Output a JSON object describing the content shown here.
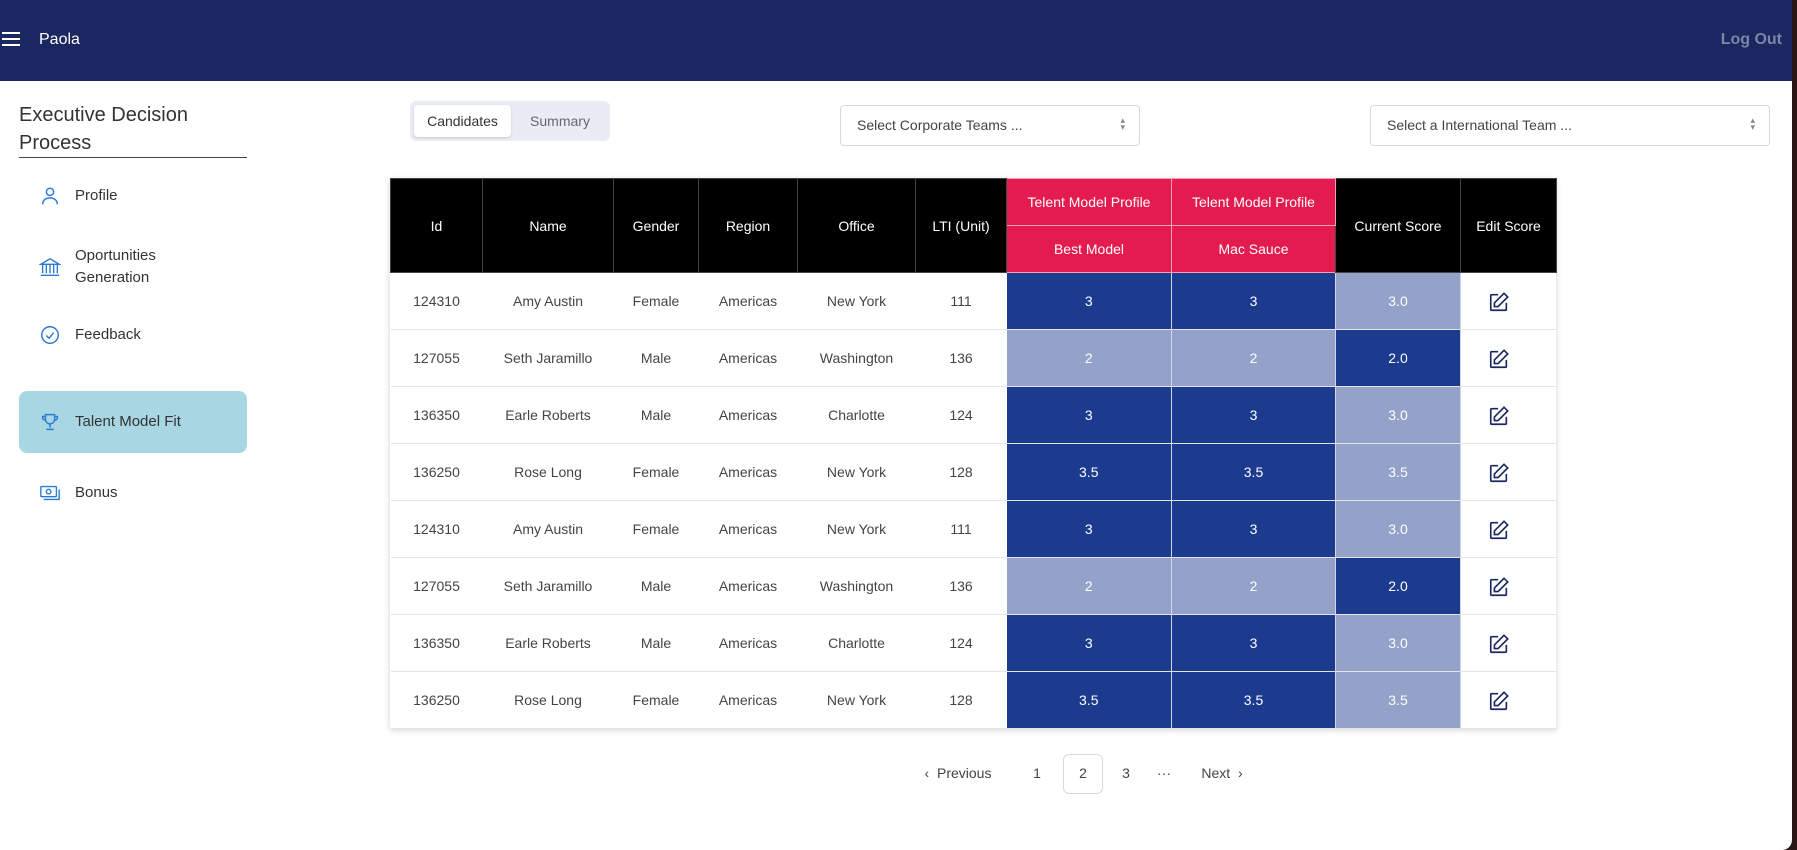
{
  "topbar": {
    "username": "Paola",
    "logout_label": "Log Out"
  },
  "sidebar": {
    "title": "Executive Decision Process",
    "items": [
      {
        "label": "Profile",
        "icon": "user-icon"
      },
      {
        "label": "Oportunities Generation",
        "icon": "bank-icon"
      },
      {
        "label": "Feedback",
        "icon": "check-circle-icon"
      },
      {
        "label": "Talent Model Fit",
        "icon": "trophy-icon",
        "active": true
      },
      {
        "label": "Bonus",
        "icon": "money-icon"
      }
    ]
  },
  "tabs": {
    "candidates": "Candidates",
    "summary": "Summary",
    "active": "Candidates"
  },
  "filters": {
    "corporate_placeholder": "Select Corporate Teams ...",
    "international_placeholder": "Select a International Team ..."
  },
  "table": {
    "headers": {
      "id": "Id",
      "name": "Name",
      "gender": "Gender",
      "region": "Region",
      "office": "Office",
      "lti": "LTI (Unit)",
      "tmp1_top": "Telent Model Profile",
      "tmp1_bottom": "Best Model",
      "tmp2_top": "Telent Model Profile",
      "tmp2_bottom": "Mac Sauce",
      "current_score": "Current Score",
      "edit_score": "Edit Score"
    },
    "rows": [
      {
        "id": "124310",
        "name": "Amy Austin",
        "gender": "Female",
        "region": "Americas",
        "office": "New York",
        "lti": "111",
        "best": "3",
        "mac": "3",
        "score": "3.0"
      },
      {
        "id": "127055",
        "name": "Seth Jaramillo",
        "gender": "Male",
        "region": "Americas",
        "office": "Washington",
        "lti": "136",
        "best": "2",
        "mac": "2",
        "score": "2.0"
      },
      {
        "id": "136350",
        "name": "Earle Roberts",
        "gender": "Male",
        "region": "Americas",
        "office": "Charlotte",
        "lti": "124",
        "best": "3",
        "mac": "3",
        "score": "3.0"
      },
      {
        "id": "136250",
        "name": "Rose Long",
        "gender": "Female",
        "region": "Americas",
        "office": "New York",
        "lti": "128",
        "best": "3.5",
        "mac": "3.5",
        "score": "3.5"
      },
      {
        "id": "124310",
        "name": "Amy Austin",
        "gender": "Female",
        "region": "Americas",
        "office": "New York",
        "lti": "111",
        "best": "3",
        "mac": "3",
        "score": "3.0"
      },
      {
        "id": "127055",
        "name": "Seth Jaramillo",
        "gender": "Male",
        "region": "Americas",
        "office": "Washington",
        "lti": "136",
        "best": "2",
        "mac": "2",
        "score": "2.0"
      },
      {
        "id": "136350",
        "name": "Earle Roberts",
        "gender": "Male",
        "region": "Americas",
        "office": "Charlotte",
        "lti": "124",
        "best": "3",
        "mac": "3",
        "score": "3.0"
      },
      {
        "id": "136250",
        "name": "Rose Long",
        "gender": "Female",
        "region": "Americas",
        "office": "New York",
        "lti": "128",
        "best": "3.5",
        "mac": "3.5",
        "score": "3.5"
      }
    ]
  },
  "pagination": {
    "previous": "Previous",
    "pages": [
      "1",
      "2",
      "3"
    ],
    "current": "2",
    "ellipsis": "···",
    "next": "Next"
  },
  "colors": {
    "topbar": "#1b2760",
    "header_black": "#000000",
    "header_pink": "#e31b4f",
    "cell_dark_blue": "#1c3b8f",
    "cell_light_blue": "#94a1c9",
    "active_sidebar": "#a9d6e3",
    "icon_blue": "#2b7bd3"
  }
}
